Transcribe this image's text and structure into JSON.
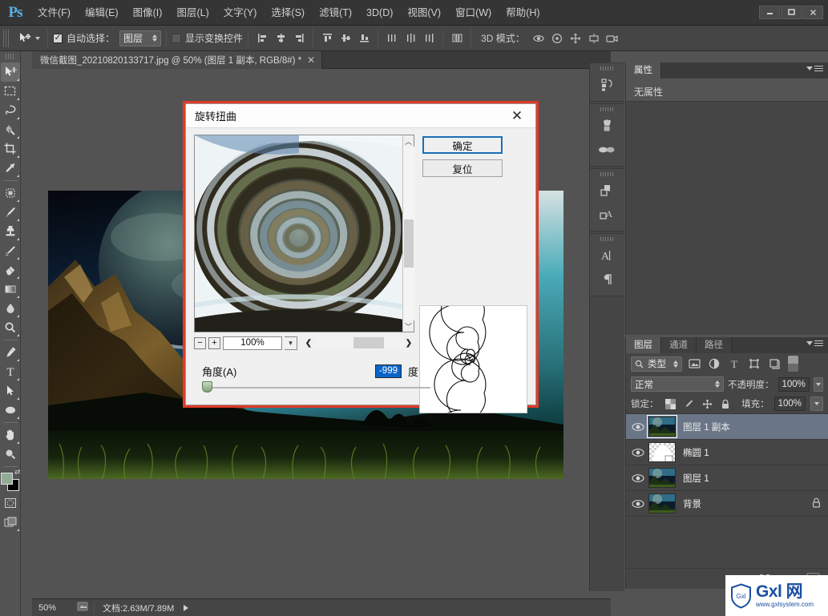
{
  "app": {
    "logo": "Ps"
  },
  "menubar": {
    "items": [
      {
        "label": "文件(F)"
      },
      {
        "label": "编辑(E)"
      },
      {
        "label": "图像(I)"
      },
      {
        "label": "图层(L)"
      },
      {
        "label": "文字(Y)"
      },
      {
        "label": "选择(S)"
      },
      {
        "label": "滤镜(T)"
      },
      {
        "label": "3D(D)"
      },
      {
        "label": "视图(V)"
      },
      {
        "label": "窗口(W)"
      },
      {
        "label": "帮助(H)"
      }
    ],
    "window_buttons": {
      "minimize": "—",
      "maximize": "❐",
      "close": "✕"
    }
  },
  "options_bar": {
    "auto_select_label": "自动选择：",
    "auto_select_checked": "✓",
    "auto_select_value": "图层",
    "show_transform_label": "显示变换控件",
    "mode_3d_label": "3D 模式："
  },
  "document_tab": {
    "title": "微信截图_20210820133717.jpg @ 50% (图层 1 副本, RGB/8#) *",
    "close": "✕"
  },
  "toolbar": {
    "tools": [
      {
        "name": "move-tool",
        "selected": true
      },
      {
        "name": "marquee-tool",
        "selected": false
      },
      {
        "name": "lasso-tool",
        "selected": false
      },
      {
        "name": "magic-wand-tool",
        "selected": false
      },
      {
        "name": "crop-tool",
        "selected": false
      },
      {
        "name": "eyedropper-tool",
        "selected": false
      },
      {
        "name": "healing-brush-tool",
        "selected": false
      },
      {
        "name": "brush-tool",
        "selected": false
      },
      {
        "name": "clone-stamp-tool",
        "selected": false
      },
      {
        "name": "history-brush-tool",
        "selected": false
      },
      {
        "name": "eraser-tool",
        "selected": false
      },
      {
        "name": "gradient-tool",
        "selected": false
      },
      {
        "name": "blur-tool",
        "selected": false
      },
      {
        "name": "dodge-tool",
        "selected": false
      },
      {
        "name": "pen-tool",
        "selected": false
      },
      {
        "name": "type-tool",
        "selected": false
      },
      {
        "name": "path-selection-tool",
        "selected": false
      },
      {
        "name": "ellipse-shape-tool",
        "selected": false
      },
      {
        "name": "hand-tool",
        "selected": false
      },
      {
        "name": "zoom-tool",
        "selected": false
      }
    ],
    "foreground_color": "#93ab95",
    "background_color": "#000000"
  },
  "status_bar": {
    "zoom": "50%",
    "doc_info": "文档:2.63M/7.89M"
  },
  "properties_panel": {
    "tabs": [
      {
        "label": "属性",
        "active": true
      }
    ],
    "empty_text": "无属性"
  },
  "layers_panel": {
    "tabs": [
      {
        "label": "图层",
        "active": true
      },
      {
        "label": "通道",
        "active": false
      },
      {
        "label": "路径",
        "active": false
      }
    ],
    "filter_type": "类型",
    "blend_mode": "正常",
    "opacity_label": "不透明度：",
    "opacity_value": "100%",
    "lock_label": "锁定：",
    "fill_label": "填充：",
    "fill_value": "100%",
    "layers": [
      {
        "name": "图层 1 副本",
        "selected": true,
        "locked": false,
        "visible": true,
        "thumb": "landscape"
      },
      {
        "name": "椭圆 1",
        "selected": false,
        "locked": false,
        "visible": true,
        "thumb": "ellipse-mask"
      },
      {
        "name": "图层 1",
        "selected": false,
        "locked": false,
        "visible": true,
        "thumb": "landscape"
      },
      {
        "name": "背景",
        "selected": false,
        "locked": true,
        "visible": true,
        "thumb": "landscape"
      }
    ]
  },
  "dialog": {
    "title": "旋转扭曲",
    "close_label": "✕",
    "ok_label": "确定",
    "reset_label": "复位",
    "zoom_out": "−",
    "zoom_in": "+",
    "zoom_value": "100%",
    "angle_label": "角度(A)",
    "angle_value": "-999",
    "angle_unit": "度",
    "scroll_left": "❮",
    "scroll_right": "❯",
    "scroll_up": "︿",
    "scroll_down": "﹀"
  },
  "watermark": {
    "brand": "Gxl 网",
    "badge": "Gxl",
    "url": "www.gxlsystem.com"
  }
}
